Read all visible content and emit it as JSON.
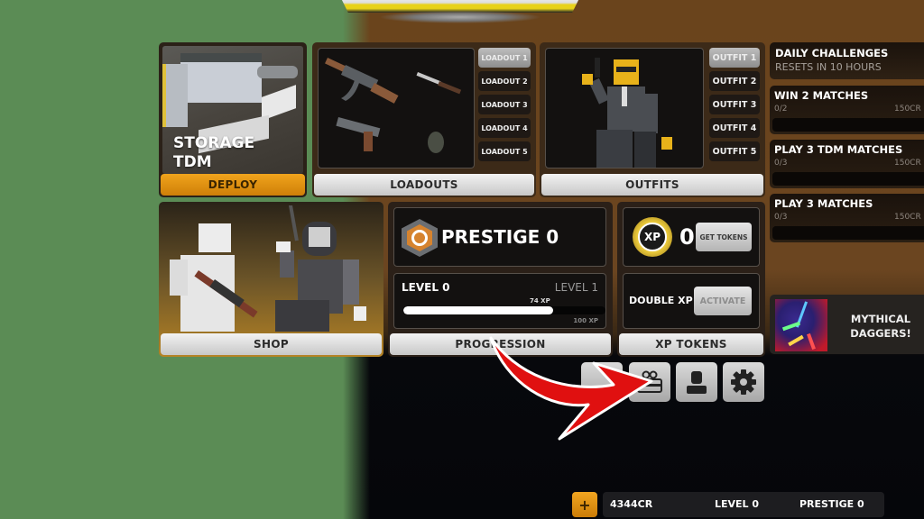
{
  "map": {
    "name_line1": "STORAGE",
    "name_line2": "TDM",
    "deploy_label": "DEPLOY"
  },
  "loadouts": {
    "label": "LOADOUTS",
    "tabs": [
      "LOADOUT 1",
      "LOADOUT 2",
      "LOADOUT 3",
      "LOADOUT 4",
      "LOADOUT 5"
    ],
    "active_index": 0
  },
  "outfits": {
    "label": "OUTFITS",
    "tabs": [
      "OUTFIT 1",
      "OUTFIT 2",
      "OUTFIT 3",
      "OUTFIT 4",
      "OUTFIT 5"
    ],
    "active_index": 0
  },
  "shop": {
    "label": "SHOP"
  },
  "progression": {
    "label": "PROGRESSION",
    "prestige_title": "PRESTIGE 0",
    "level_current": "LEVEL 0",
    "level_next": "LEVEL 1",
    "xp_current": "74 XP",
    "xp_max": "100 XP",
    "xp_progress": 0.74
  },
  "xp_tokens": {
    "label": "XP TOKENS",
    "coin_label": "XP",
    "count": "0",
    "get_tokens_label": "GET TOKENS",
    "double_xp_label": "DOUBLE XP",
    "activate_label": "ACTIVATE"
  },
  "challenges": {
    "title": "DAILY CHALLENGES",
    "subtitle": "RESETS IN 10 HOURS",
    "items": [
      {
        "name": "WIN 2 MATCHES",
        "progress": "0/2",
        "reward": "150CR"
      },
      {
        "name": "PLAY 3 TDM MATCHES",
        "progress": "0/3",
        "reward": "150CR"
      },
      {
        "name": "PLAY 3 MATCHES",
        "progress": "0/3",
        "reward": "150CR"
      }
    ]
  },
  "promo": {
    "line1": "MYTHICAL",
    "line2": "DAGGERS!"
  },
  "icon_buttons": [
    "hidden-button",
    "gift-card-icon",
    "profile-icon",
    "gear-icon"
  ],
  "status": {
    "plus_label": "+",
    "credits": "4344CR",
    "level": "LEVEL 0",
    "prestige": "PRESTIGE 0"
  },
  "colors": {
    "accent_gold": "#e8950f",
    "arrow_red": "#e01010",
    "bg_green": "#5b8c55",
    "bg_brown": "#6a441c"
  }
}
